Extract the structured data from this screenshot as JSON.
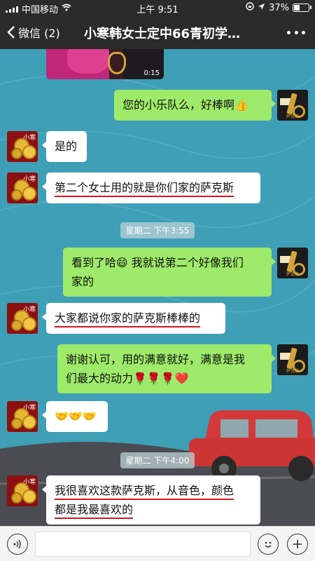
{
  "status_bar": {
    "carrier": "中国移动",
    "time": "上午 9:51",
    "battery": "37%",
    "battery_level": 0.37
  },
  "nav": {
    "back_label": "微信 (2)",
    "title": "小寒韩女士定中66青初学…"
  },
  "messages": {
    "video_duration": "0:15",
    "m1": "您的小乐队么，好棒啊👍",
    "m2": "是的",
    "m3": "第二个女士用的就是你们家的萨克斯",
    "t1": "星期二 下午3:55",
    "m4_line1": "看到了哈😄 我就说第二个好像我们",
    "m4_line2": "家的",
    "m5": "大家都说你家的萨克斯棒棒的",
    "m6_line1": "谢谢认可，用的满意就好，满意是我",
    "m6_line2": "们最大的动力🌹🌹🌹❤️",
    "m7": "🤝🤝🤝",
    "t2": "星期二 下午4:00",
    "m8_line1": "我很喜欢这款萨克斯，从音色，颜色",
    "m8_line2": "都是我最喜欢的"
  },
  "avatars": {
    "contact_label": "小寒"
  },
  "colors": {
    "accent_red": "#d8131d",
    "bubble_green": "#9eea6a"
  }
}
